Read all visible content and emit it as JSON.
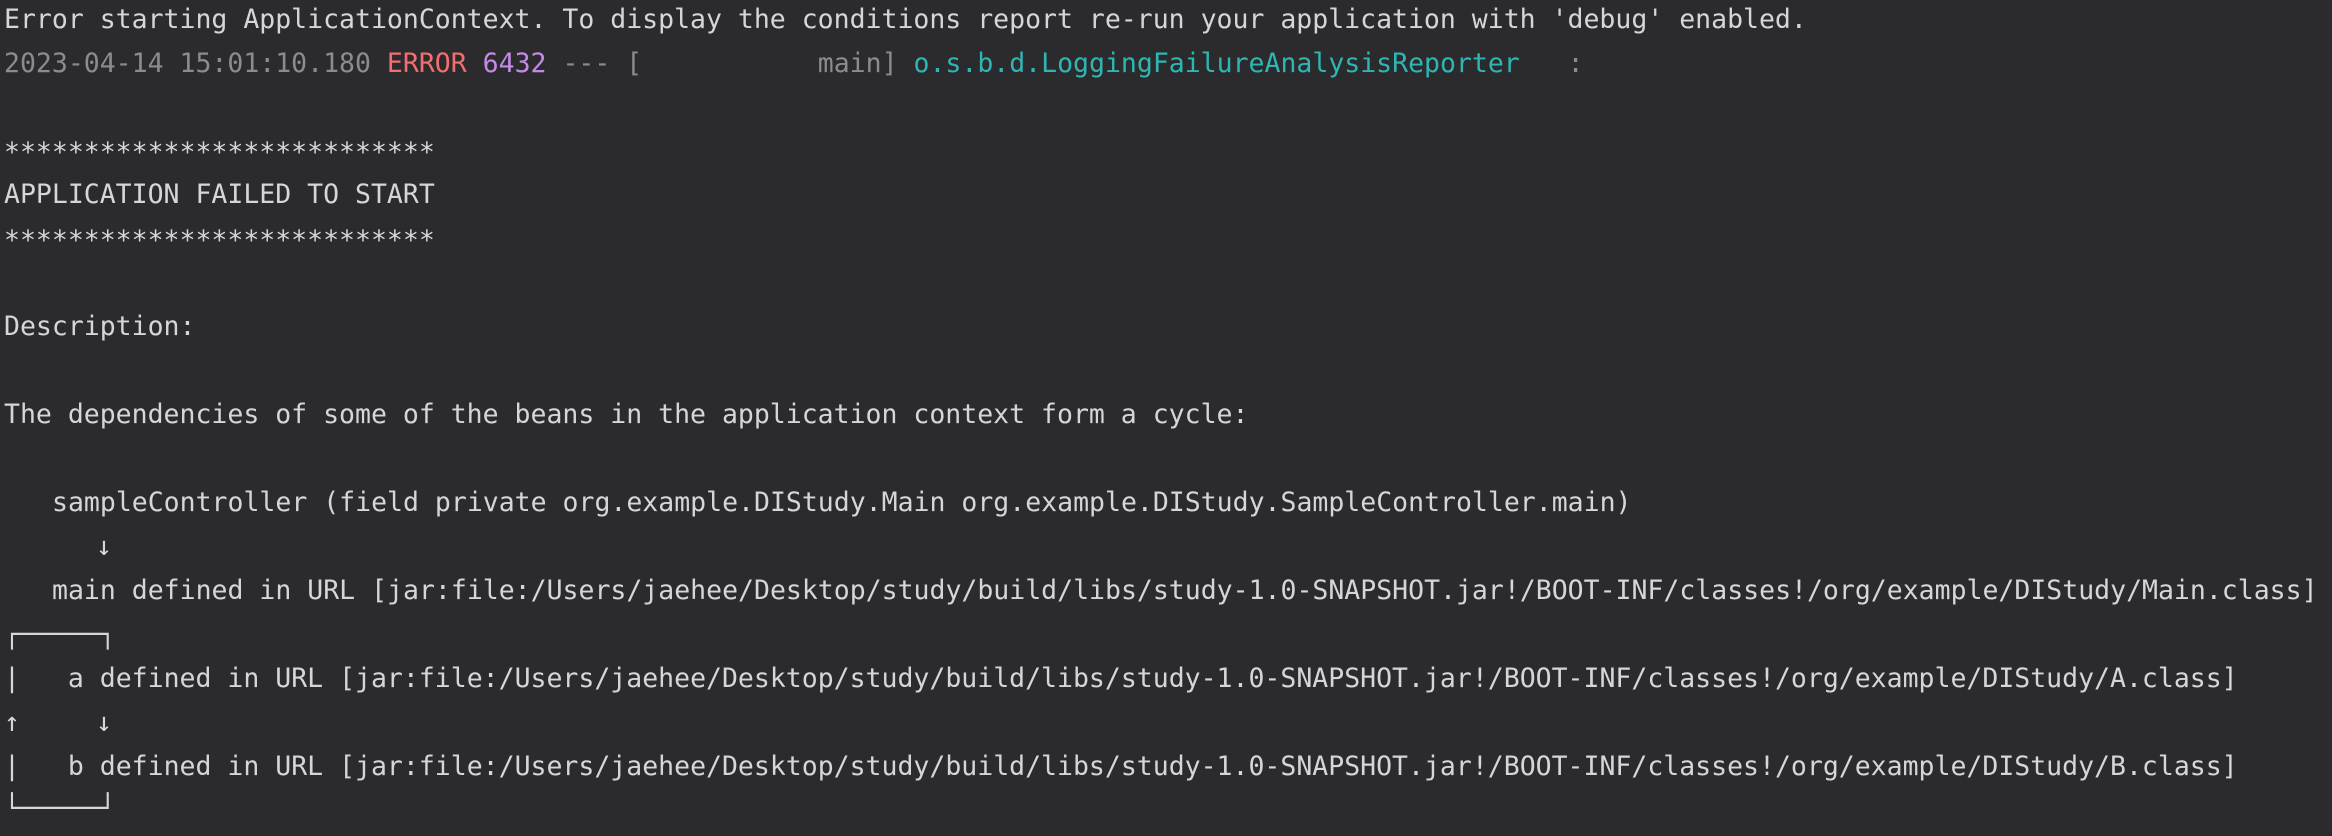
{
  "console": {
    "error_banner": "Error starting ApplicationContext. To display the conditions report re-run your application with 'debug' enabled.",
    "log_entry": {
      "timestamp": "2023-04-14 15:01:10.180",
      "level": "ERROR",
      "pid": "6432",
      "separator": "--- [",
      "thread": "           main]",
      "logger": "o.s.b.d.LoggingFailureAnalysisReporter",
      "colon": ":"
    },
    "stars_top": "***************************",
    "failure_title": "APPLICATION FAILED TO START",
    "stars_bottom": "***************************",
    "description_label": "Description:",
    "cycle_message": "The dependencies of some of the beans in the application context form a cycle:",
    "chain": {
      "controller_line": "sampleController (field private org.example.DIStudy.Main org.example.DIStudy.SampleController.main)",
      "down_arrow": "↓",
      "main_line": "main defined in URL [jar:file:/Users/jaehee/Desktop/study/build/libs/study-1.0-SNAPSHOT.jar!/BOOT-INF/classes!/org/example/DIStudy/Main.class]",
      "box_top": "┌─────┐",
      "a_prefix": "|  ",
      "a_line": "a defined in URL [jar:file:/Users/jaehee/Desktop/study/build/libs/study-1.0-SNAPSHOT.jar!/BOOT-INF/classes!/org/example/DIStudy/A.class]",
      "up_arrow": "↑",
      "cycle_down_arrow": "↓",
      "b_prefix": "|  ",
      "b_line": "b defined in URL [jar:file:/Users/jaehee/Desktop/study/build/libs/study-1.0-SNAPSHOT.jar!/BOOT-INF/classes!/org/example/DIStudy/B.class]",
      "box_bottom": "└─────┘"
    }
  },
  "colors": {
    "background": "#2b2b2d",
    "text": "#d4d6da",
    "timestamp": "#8a8c90",
    "error": "#f26f6f",
    "pid": "#c38ae6",
    "logger": "#2fb6b4"
  }
}
